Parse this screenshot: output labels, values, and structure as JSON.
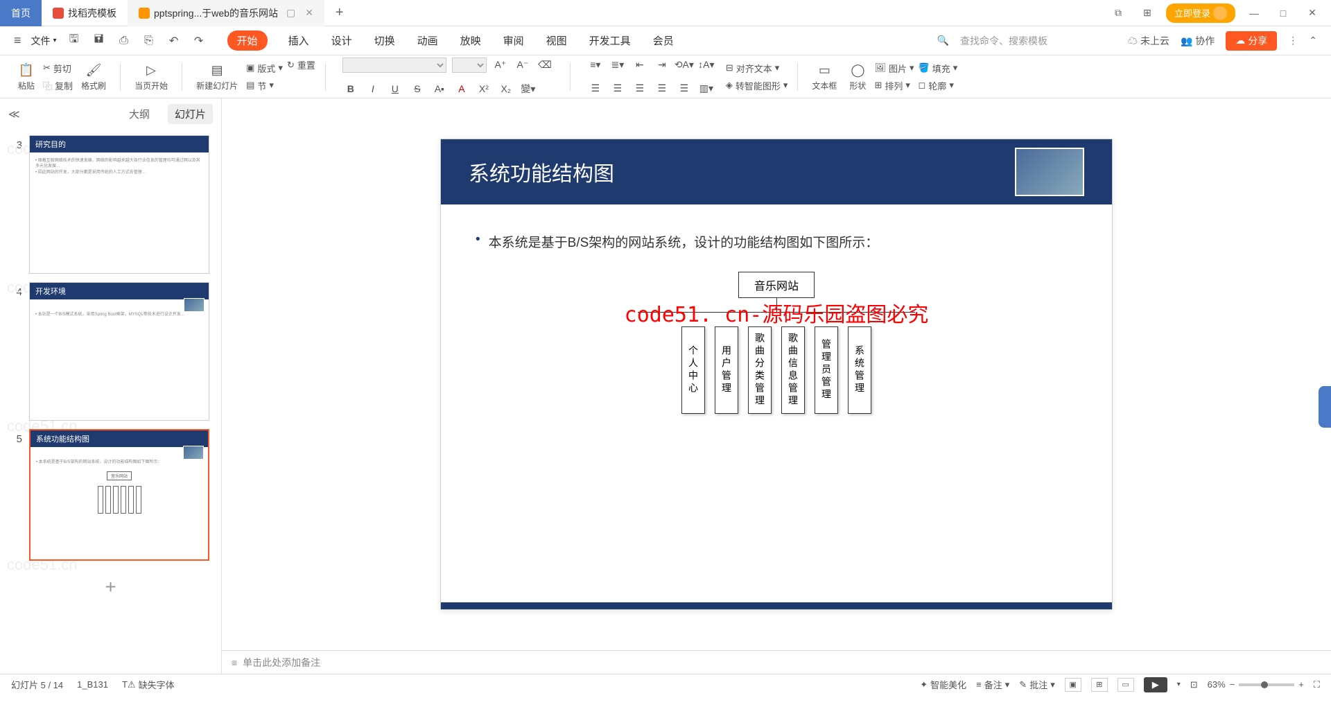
{
  "titlebar": {
    "home_tab": "首页",
    "tab1": "找稻壳模板",
    "tab2": "pptspring...于web的音乐网站",
    "login": "立即登录"
  },
  "menubar": {
    "file": "文件",
    "tabs": [
      "开始",
      "插入",
      "设计",
      "切换",
      "动画",
      "放映",
      "审阅",
      "视图",
      "开发工具",
      "会员"
    ],
    "search_placeholder": "查找命令、搜索模板",
    "cloud": "未上云",
    "collab": "协作",
    "share": "分享"
  },
  "toolbar": {
    "paste": "粘贴",
    "cut": "剪切",
    "copy": "复制",
    "format_painter": "格式刷",
    "current_page": "当页开始",
    "new_slide": "新建幻灯片",
    "layout": "版式",
    "section": "节",
    "reset": "重置",
    "align_text": "对齐文本",
    "convert_shape": "转智能图形",
    "textbox": "文本框",
    "shape": "形状",
    "picture": "图片",
    "arrange": "排列",
    "fill": "填充",
    "outline": "轮廓"
  },
  "sidebar": {
    "outline_tab": "大纲",
    "slides_tab": "幻灯片",
    "thumbs": [
      {
        "num": "3",
        "title": "研究目的"
      },
      {
        "num": "4",
        "title": "开发环境"
      },
      {
        "num": "5",
        "title": "系统功能结构图"
      }
    ]
  },
  "slide": {
    "title": "系统功能结构图",
    "bullet": "本系统是基于B/S架构的网站系统，设计的功能结构图如下图所示：",
    "diagram_root": "音乐网站",
    "diagram_nodes": [
      "个人中心",
      "用户管理",
      "歌曲分类管理",
      "歌曲信息管理",
      "管理员管理",
      "系统管理"
    ],
    "watermark": "code51. cn-源码乐园盗图必究",
    "wm_bg": "code51.cn"
  },
  "notes": {
    "placeholder": "单击此处添加备注"
  },
  "status": {
    "slide_info": "幻灯片 5 / 14",
    "section": "1_B131",
    "missing_font": "缺失字体",
    "beautify": "智能美化",
    "notes": "备注",
    "comments": "批注",
    "zoom": "63%"
  }
}
